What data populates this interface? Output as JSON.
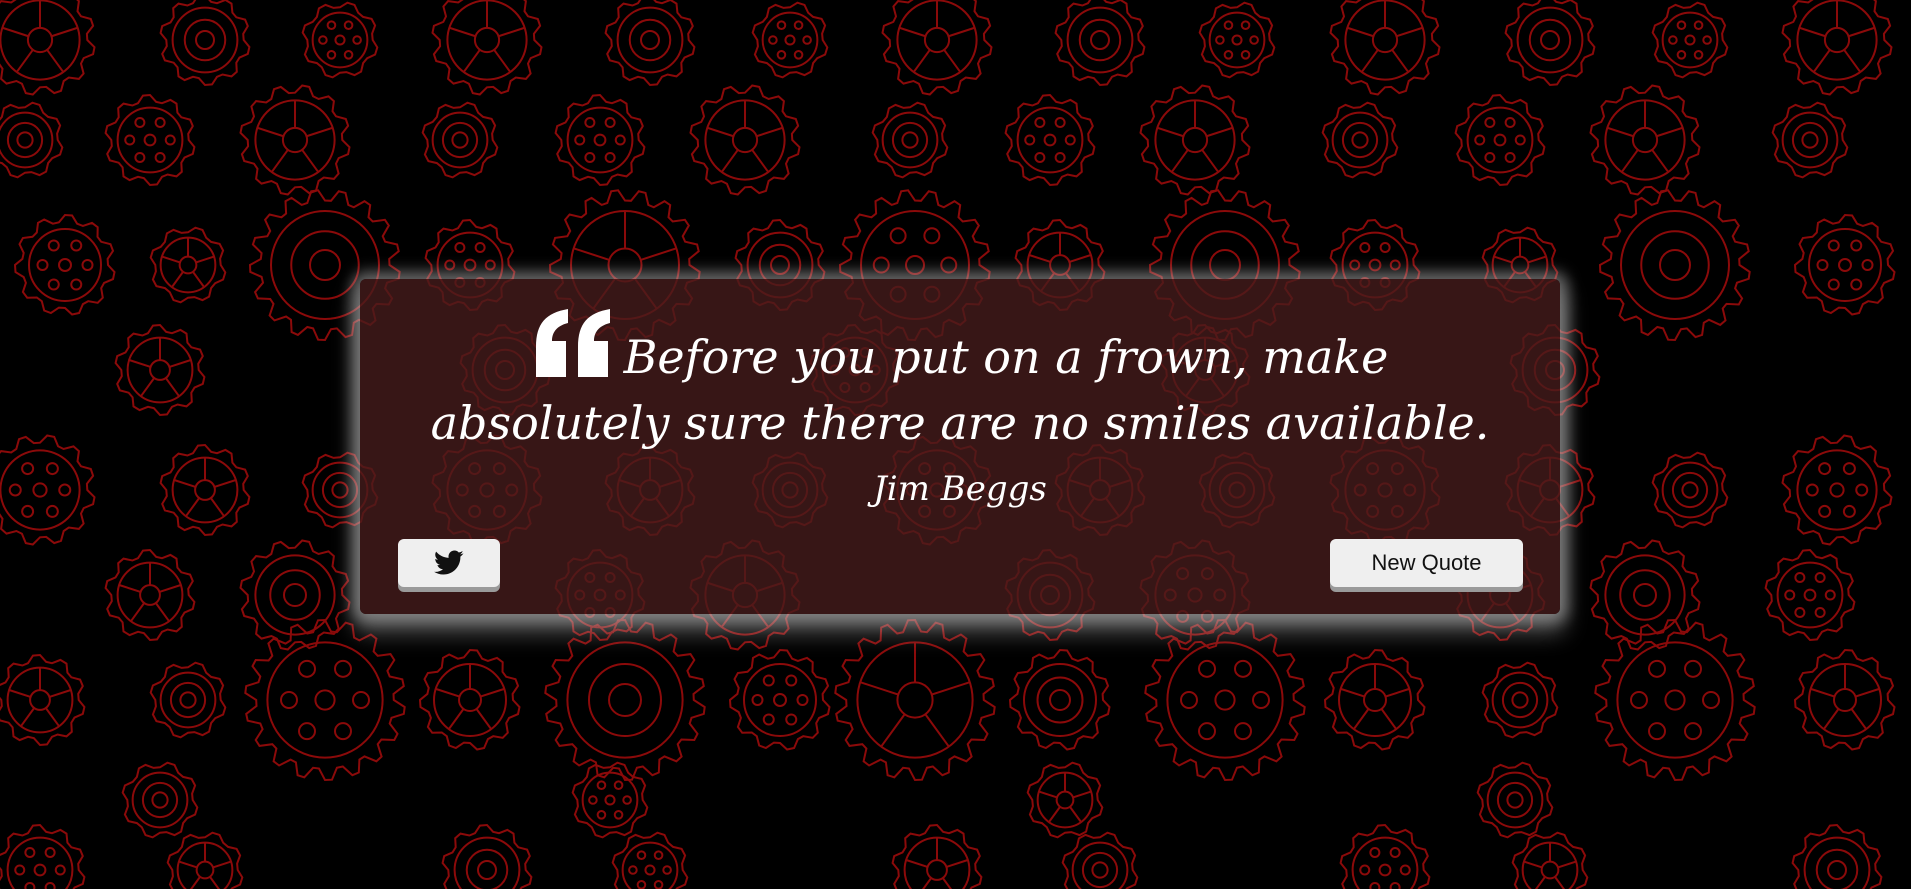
{
  "quote": {
    "icon": "quote-left-icon",
    "text": "Before you put on a frown, make absolutely sure there are no smiles available.",
    "author": "Jim Beggs"
  },
  "buttons": {
    "tweet_icon": "twitter-icon",
    "new_quote_label": "New Quote"
  },
  "colors": {
    "background": "#000000",
    "gear_pattern": "#8b0a0a",
    "card": "#461c1c",
    "button": "#efefef",
    "text": "#ffffff"
  }
}
